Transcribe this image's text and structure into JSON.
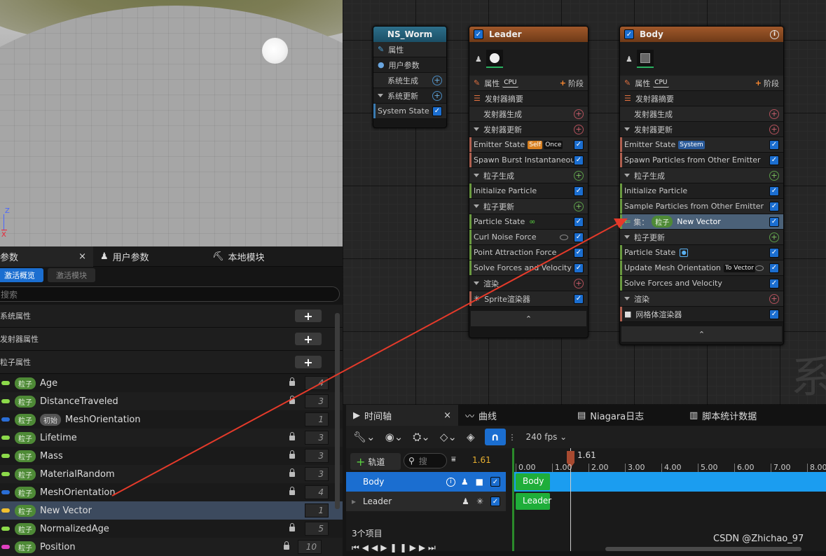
{
  "viewport": {
    "axis_z": "Z",
    "axis_x": "X"
  },
  "nodes": {
    "system": {
      "title": "NS_Worm",
      "rows": [
        "属性",
        "用户参数",
        "系统生成",
        "系统更新",
        "System State"
      ]
    },
    "leader": {
      "title": "Leader",
      "props": "属性",
      "cpu": "CPU",
      "stage": "阶段",
      "summary": "发射器摘要",
      "emitter_spawn": "发射器生成",
      "emitter_update": "发射器更新",
      "emitter_state": "Emitter State",
      "self": "Self",
      "once": "Once",
      "spawn_burst": "Spawn Burst Instantaneous",
      "particle_spawn": "粒子生成",
      "init_particle": "Initialize Particle",
      "particle_update": "粒子更新",
      "particle_state": "Particle State",
      "curl_noise": "Curl Noise Force",
      "point_attr": "Point Attraction Force",
      "solve_forces": "Solve Forces and Velocity",
      "render": "渲染",
      "sprite": "Sprite渲染器"
    },
    "body": {
      "title": "Body",
      "props": "属性",
      "cpu": "CPU",
      "stage": "阶段",
      "summary": "发射器摘要",
      "emitter_spawn": "发射器生成",
      "emitter_update": "发射器更新",
      "emitter_state": "Emitter State",
      "system": "System",
      "spawn_other": "Spawn Particles from Other Emitter",
      "particle_spawn": "粒子生成",
      "init_particle": "Initialize Particle",
      "sample_other": "Sample Particles from Other Emitter",
      "set_label": "集：",
      "set_badge": "粒子",
      "set_var": "New Vector",
      "particle_update": "粒子更新",
      "particle_state": "Particle State",
      "update_mesh": "Update Mesh Orientation",
      "to_vector": "To Vector",
      "solve_forces": "Solve Forces and Velocity",
      "render": "渲染",
      "mesh_renderer": "网格体渲染器"
    }
  },
  "watermark_graph": "系",
  "params": {
    "tabs": [
      "参数",
      "用户参数",
      "本地模块"
    ],
    "close": "×",
    "subtabs": [
      "激活概览",
      "激活模块"
    ],
    "search_placeholder": "搜索",
    "groups": [
      "系统属性",
      "发射器属性",
      "粒子属性"
    ],
    "rows": [
      {
        "badge": "粒子",
        "init": "",
        "name": "Age",
        "value": "4",
        "color": "#8cd94a",
        "locked": true
      },
      {
        "badge": "粒子",
        "init": "",
        "name": "DistanceTraveled",
        "value": "3",
        "color": "#8cd94a",
        "locked": true
      },
      {
        "badge": "粒子",
        "init": "初始",
        "name": "MeshOrientation",
        "value": "1",
        "color": "#2a6ed6",
        "locked": false
      },
      {
        "badge": "粒子",
        "init": "",
        "name": "Lifetime",
        "value": "3",
        "color": "#8cd94a",
        "locked": true
      },
      {
        "badge": "粒子",
        "init": "",
        "name": "Mass",
        "value": "3",
        "color": "#8cd94a",
        "locked": true
      },
      {
        "badge": "粒子",
        "init": "",
        "name": "MaterialRandom",
        "value": "3",
        "color": "#8cd94a",
        "locked": true
      },
      {
        "badge": "粒子",
        "init": "",
        "name": "MeshOrientation",
        "value": "4",
        "color": "#2a6ed6",
        "locked": true
      },
      {
        "badge": "粒子",
        "init": "",
        "name": "New Vector",
        "value": "1",
        "color": "#f0c030",
        "locked": false
      },
      {
        "badge": "粒子",
        "init": "",
        "name": "NormalizedAge",
        "value": "5",
        "color": "#8cd94a",
        "locked": true
      },
      {
        "badge": "粒子",
        "init": "",
        "name": "Position",
        "value": "10",
        "color": "#e040c0",
        "locked": true
      }
    ]
  },
  "sequencer": {
    "tabs": [
      "时间轴",
      "曲线",
      "Niagara日志",
      "脚本统计数据"
    ],
    "close": "×",
    "fps": "240 fps",
    "track_btn": "轨道",
    "search_ph": "搜",
    "current": "1.61",
    "playhead": "1.61",
    "tracks": [
      "Body",
      "Leader"
    ],
    "items": "3个项目",
    "ticks": [
      "0.00",
      "1.00",
      "2.00",
      "3.00",
      "4.00",
      "5.00",
      "6.00",
      "7.00",
      "8.00"
    ]
  },
  "credit": "CSDN @Zhichao_97"
}
